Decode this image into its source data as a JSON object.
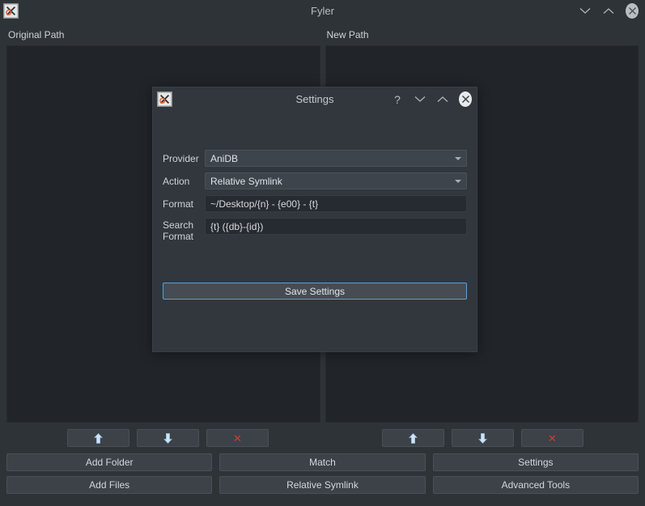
{
  "window": {
    "title": "Fyler",
    "icon": "app-logo-icon",
    "controls": [
      {
        "name": "minimize-button",
        "glyph": "chevron-down-icon"
      },
      {
        "name": "maximize-button",
        "glyph": "chevron-up-icon"
      },
      {
        "name": "close-button",
        "glyph": "close-icon"
      }
    ]
  },
  "panes": [
    {
      "label": "Original Path",
      "items": []
    },
    {
      "label": "New Path",
      "items": []
    }
  ],
  "toolbar": {
    "arrow_buttons_left": [
      {
        "name": "move-up-button-left",
        "icon": "arrow-up-icon"
      },
      {
        "name": "move-down-button-left",
        "icon": "arrow-down-icon"
      },
      {
        "name": "remove-button-left",
        "icon": "x-icon",
        "label": "✕"
      }
    ],
    "arrow_buttons_right": [
      {
        "name": "move-up-button-right",
        "icon": "arrow-up-icon"
      },
      {
        "name": "move-down-button-right",
        "icon": "arrow-down-icon"
      },
      {
        "name": "remove-button-right",
        "icon": "x-icon",
        "label": "✕"
      }
    ],
    "row1": [
      {
        "label": "Add Folder"
      },
      {
        "label": "Match"
      },
      {
        "label": "Settings"
      }
    ],
    "row2": [
      {
        "label": "Add Files"
      },
      {
        "label": "Relative Symlink"
      },
      {
        "label": "Advanced Tools"
      }
    ]
  },
  "dialog": {
    "title": "Settings",
    "icon": "app-logo-icon",
    "controls": [
      {
        "name": "help-button",
        "glyph": "question-mark-icon",
        "label": "?"
      },
      {
        "name": "minimize-button",
        "glyph": "chevron-down-icon"
      },
      {
        "name": "maximize-button",
        "glyph": "chevron-up-icon"
      },
      {
        "name": "close-button",
        "glyph": "close-icon"
      }
    ],
    "fields": {
      "provider": {
        "label": "Provider",
        "value": "AniDB",
        "type": "combobox"
      },
      "action": {
        "label": "Action",
        "value": "Relative Symlink",
        "type": "combobox"
      },
      "format": {
        "label": "Format",
        "value": "~/Desktop/{n} - {e00} - {t}",
        "type": "text"
      },
      "search_format": {
        "label": "Search Format",
        "label_line1": "Search",
        "label_line2": "Format",
        "value": "{t} ({db}-{id})",
        "type": "text"
      }
    },
    "save_label": "Save Settings"
  },
  "colors": {
    "window_bg": "#2e3338",
    "dialog_bg": "#31373d",
    "list_bg": "#21252a",
    "button_bg": "#3c4248",
    "combo_bg": "#3e444b",
    "input_bg": "#262b31",
    "focus_border": "#5d9fd6",
    "text": "#d3d7da",
    "danger": "#d03a37"
  }
}
